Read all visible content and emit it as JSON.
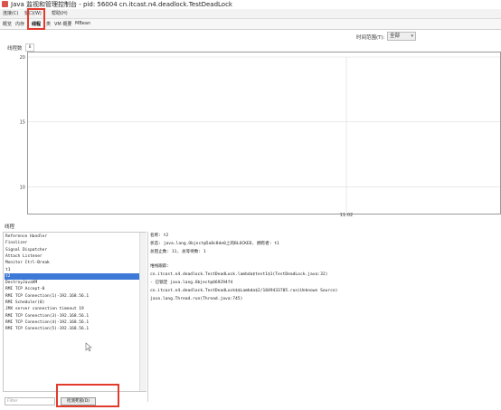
{
  "window": {
    "title": "Java 监视和管理控制台 - pid: 56004 cn.itcast.n4.deadlock.TestDeadLock"
  },
  "menu": {
    "items": [
      "连接(C)",
      "窗口(W)",
      "帮助(H)"
    ]
  },
  "tabs": [
    "概览",
    "内存",
    "线程",
    "类",
    "VM 概要",
    "MBean"
  ],
  "time_range": {
    "label": "时间范围(T):",
    "value": "全部"
  },
  "chart": {
    "title": "线程数",
    "badge": "8"
  },
  "chart_data": {
    "type": "line",
    "title": "",
    "xlabel": "",
    "ylabel": "",
    "y_ticks": [
      10,
      15,
      20
    ],
    "x_ticks": [
      "11:02"
    ],
    "ylim": [
      8,
      20
    ],
    "grid": true,
    "series": [
      {
        "values": []
      }
    ]
  },
  "threads_section": {
    "label": "线程"
  },
  "thread_list": [
    "Reference Handler",
    "Finalizer",
    "Signal Dispatcher",
    "Attach Listener",
    "Monitor Ctrl-Break",
    "t1",
    "t2",
    "DestroyJavaVM",
    "RMI TCP Accept-0",
    "RMI TCP Connection(1)-192.168.56.1",
    "RMI Scheduler(0)",
    "JMX server connection timeout 19",
    "RMI TCP Connection(3)-192.168.56.1",
    "RMI TCP Connection(4)-192.168.56.1",
    "RMI TCP Connection(5)-192.168.56.1"
  ],
  "selected_thread": "t2",
  "details": [
    "名称: t2",
    "状态: java.lang.Object@5a8c8de0上的BLOCKED, 拥有者: t1",
    "总阻止数: 11, 总等待数: 1",
    "",
    "堆栈跟踪:",
    "cn.itcast.n4.deadlock.TestDeadLock.lambda$test1$1(TestDeadLock.java:32)",
    "   - 已锁定 java.lang.Object@469294f4",
    "cn.itcast.n4.deadlock.TestDeadLock$$Lambda$2/1849433705.run(Unknown Source)",
    "java.lang.Thread.run(Thread.java:745)"
  ],
  "filter": {
    "placeholder": "Filter"
  },
  "detect_button": {
    "label": "检测死锁(D)"
  },
  "colors": {
    "highlight": "#e23b2e",
    "selection": "#3d79d6"
  }
}
